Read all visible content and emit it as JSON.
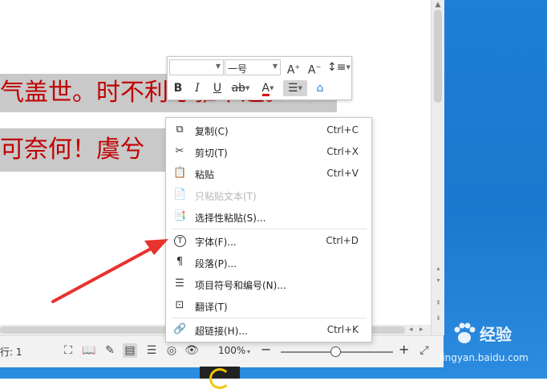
{
  "document": {
    "line1": "气盖世。时不利兮骓不逝。",
    "line2": "可奈何！虞兮",
    "text_color": "#c00000",
    "highlight_color": "#c9c9c9"
  },
  "mini_toolbar": {
    "font_name": "",
    "font_size": "一号",
    "bold": "B",
    "italic": "I",
    "underline": "U",
    "font_color_glyph": "A",
    "grow_glyph": "A",
    "shrink_glyph": "A",
    "font_color": "#e00000"
  },
  "context_menu": {
    "items": [
      {
        "label": "复制(C)",
        "shortcut": "Ctrl+C",
        "icon": "copy-icon",
        "enabled": true
      },
      {
        "label": "剪切(T)",
        "shortcut": "Ctrl+X",
        "icon": "cut-icon",
        "enabled": true
      },
      {
        "label": "粘贴",
        "shortcut": "Ctrl+V",
        "icon": "paste-icon",
        "enabled": true
      },
      {
        "label": "只粘贴文本(T)",
        "shortcut": "",
        "icon": "paste-text-icon",
        "enabled": false
      },
      {
        "label": "选择性粘贴(S)...",
        "shortcut": "",
        "icon": "paste-special-icon",
        "enabled": true
      },
      {
        "label": "字体(F)...",
        "shortcut": "Ctrl+D",
        "icon": "font-icon",
        "enabled": true
      },
      {
        "label": "段落(P)...",
        "shortcut": "",
        "icon": "paragraph-icon",
        "enabled": true
      },
      {
        "label": "项目符号和编号(N)...",
        "shortcut": "",
        "icon": "bullets-icon",
        "enabled": true
      },
      {
        "label": "翻译(T)",
        "shortcut": "",
        "icon": "translate-icon",
        "enabled": true
      },
      {
        "label": "超链接(H)...",
        "shortcut": "Ctrl+K",
        "icon": "hyperlink-icon",
        "enabled": true
      }
    ]
  },
  "status_bar": {
    "line_label": "行: 1",
    "zoom": "100%",
    "zoom_minus": "−",
    "zoom_plus": "+"
  },
  "watermark": {
    "brand": "经验",
    "url": "jingyan.baidu.com"
  },
  "colors": {
    "annotation_arrow": "#e8322e",
    "desktop": "#1b78cf"
  }
}
